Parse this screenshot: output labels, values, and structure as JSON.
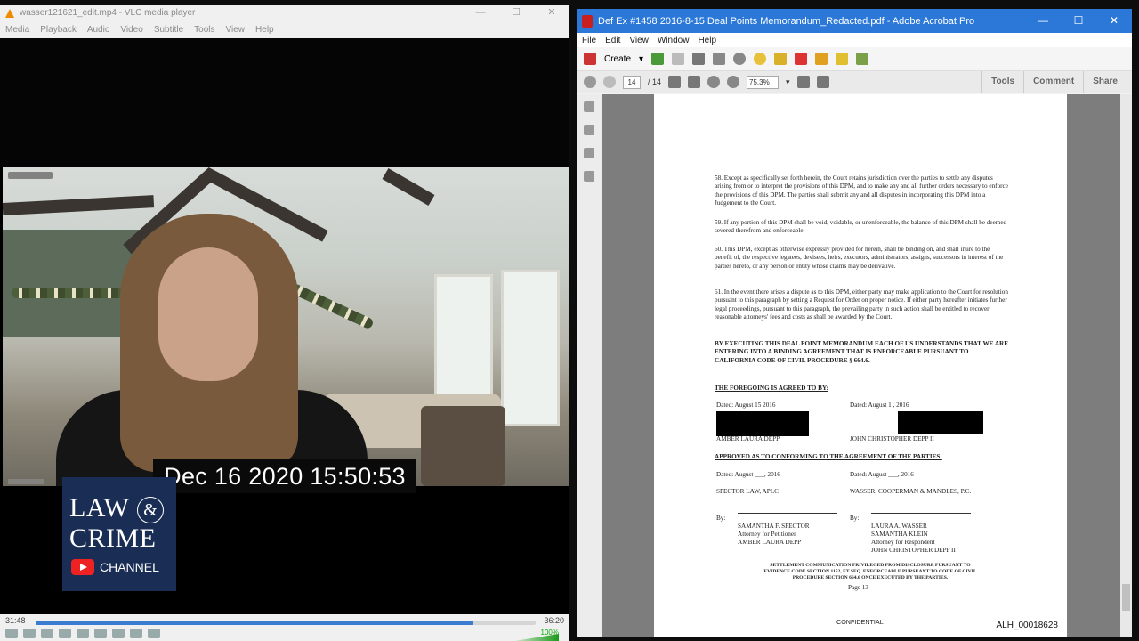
{
  "vlc": {
    "title": "wasser121621_edit.mp4 - VLC media player",
    "menu": [
      "Media",
      "Playback",
      "Audio",
      "Video",
      "Subtitle",
      "Tools",
      "View",
      "Help"
    ],
    "timestamp": "Dec 16 2020 15:50:53",
    "elapsed": "31:48",
    "duration": "36:20",
    "progress": 0.875,
    "volume": "100%"
  },
  "logo": {
    "line1": "LAW",
    "amp": "&",
    "line2": "CRIME",
    "channel": "CHANNEL"
  },
  "acrobat": {
    "title": "Def Ex #1458 2016-8-15 Deal Points Memorandum_Redacted.pdf - Adobe Acrobat Pro",
    "menu": [
      "File",
      "Edit",
      "View",
      "Window",
      "Help"
    ],
    "create_label": "Create",
    "page_current": "14",
    "page_total": "/ 14",
    "zoom": "75.3%",
    "right_links": [
      "Tools",
      "Comment",
      "Share"
    ]
  },
  "doc": {
    "p58": "58.     Except as specifically set forth herein, the Court retains jurisdiction over the parties to settle any disputes arising from or to interpret the provisions of this DPM, and to make any and all further orders necessary to enforce the provisions of this DPM. The parties shall submit any and all disputes in incorporating this DPM into a Judgement to the Court.",
    "p59": "59.     If any portion of this DPM shall be void, voidable, or unenforceable, the balance of this DPM shall be deemed severed therefrom and enforceable.",
    "p60": "60.     This DPM, except as otherwise expressly provided for herein, shall be binding on, and shall inure to the benefit of, the respective legatees, devisees, heirs, executors, administrators, assigns, successors in interest of the parties hereto, or any person or entity whose claims may be derivative.",
    "p61": "61.     In the event there arises a dispute as to this DPM, either party may make application to the Court for resolution pursuant to this paragraph by setting a Request for Order on proper notice. If either party hereafter initiates further legal proceedings, pursuant to this paragraph, the prevailing party in such action shall be entitled to recover reasonable attorneys' fees and costs as shall be awarded by the Court.",
    "bold_clause": "BY EXECUTING THIS DEAL POINT MEMORANDUM EACH OF US UNDERSTANDS THAT WE ARE ENTERING INTO A BINDING AGREEMENT THAT IS ENFORCEABLE PURSUANT TO CALIFORNIA CODE OF CIVIL PROCEDURE § 664.6.",
    "agreed_heading": "THE FOREGOING IS AGREED TO BY:",
    "dated_left": "Dated: August  15  2016",
    "dated_right": "Dated: August  1 , 2016",
    "name_left": "AMBER LAURA DEPP",
    "name_right": "JOHN CHRISTOPHER DEPP II",
    "approved_heading": "APPROVED AS TO CONFORMING TO THE AGREEMENT OF THE PARTIES:",
    "dated_left2": "Dated: August ___, 2016",
    "dated_right2": "Dated: August ___, 2016",
    "firm_left": "SPECTOR LAW, APLC",
    "firm_right": "WASSER, COOPERMAN & MANDLES, P.C.",
    "by": "By:",
    "sig_left": [
      "SAMANTHA F. SPECTOR",
      "Attorney for Petitioner",
      "AMBER LAURA DEPP"
    ],
    "sig_right": [
      "LAURA A. WASSER",
      "SAMANTHA KLEIN",
      "Attorney for Respondent",
      "JOHN CHRISTOPHER DEPP II"
    ],
    "settlement": "SETTLEMENT COMMUNICATION PRIVILEGED FROM DISCLOSURE PURSUANT TO EVIDENCE CODE SECTION 1152, ET SEQ. ENFORCEABLE PURSUANT TO CODE OF CIVIL PROCEDURE SECTION 664.6 ONCE EXECUTED BY THE PARTIES.",
    "page_no": "Page 13",
    "confidential": "CONFIDENTIAL",
    "bates": "ALH_00018628"
  }
}
